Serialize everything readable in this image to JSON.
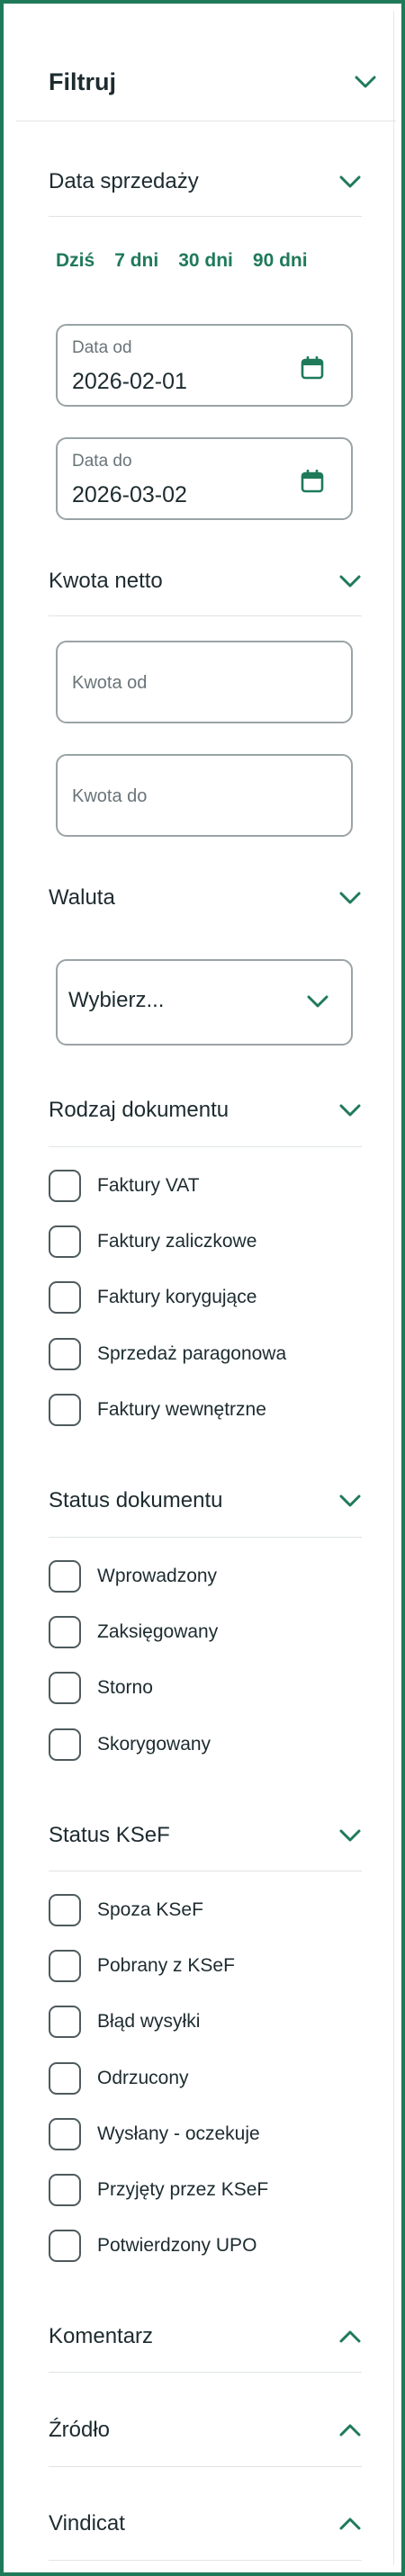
{
  "filter": {
    "title": "Filtruj",
    "icon": "chevron-down-icon"
  },
  "sale_date": {
    "title": "Data sprzedaży",
    "quick_ranges": [
      "Dziś",
      "7 dni",
      "30 dni",
      "90 dni"
    ],
    "from": {
      "label": "Data od",
      "value": "2026-02-01",
      "icon": "calendar-icon"
    },
    "to": {
      "label": "Data do",
      "value": "2026-03-02",
      "icon": "calendar-icon"
    }
  },
  "net_amount": {
    "title": "Kwota netto",
    "from_placeholder": "Kwota od",
    "to_placeholder": "Kwota do"
  },
  "currency": {
    "title": "Waluta",
    "selected": "Wybierz..."
  },
  "document_type": {
    "title": "Rodzaj dokumentu",
    "options": [
      "Faktury VAT",
      "Faktury zaliczkowe",
      "Faktury korygujące",
      "Sprzedaż paragonowa",
      "Faktury wewnętrzne"
    ]
  },
  "document_status": {
    "title": "Status dokumentu",
    "options": [
      "Wprowadzony",
      "Zaksięgowany",
      "Storno",
      "Skorygowany"
    ]
  },
  "ksef_status": {
    "title": "Status KSeF",
    "options": [
      "Spoza KSeF",
      "Pobrany z KSeF",
      "Błąd wysyłki",
      "Odrzucony",
      "Wysłany - oczekuje",
      "Przyjęty przez KSeF",
      "Potwierdzony UPO"
    ]
  },
  "comment": {
    "title": "Komentarz"
  },
  "source": {
    "title": "Źródło"
  },
  "vindicat": {
    "title": "Vindicat"
  },
  "colors": {
    "accent": "#1f7a5a",
    "border": "#9aa3a6",
    "text": "#1d2b2f"
  }
}
